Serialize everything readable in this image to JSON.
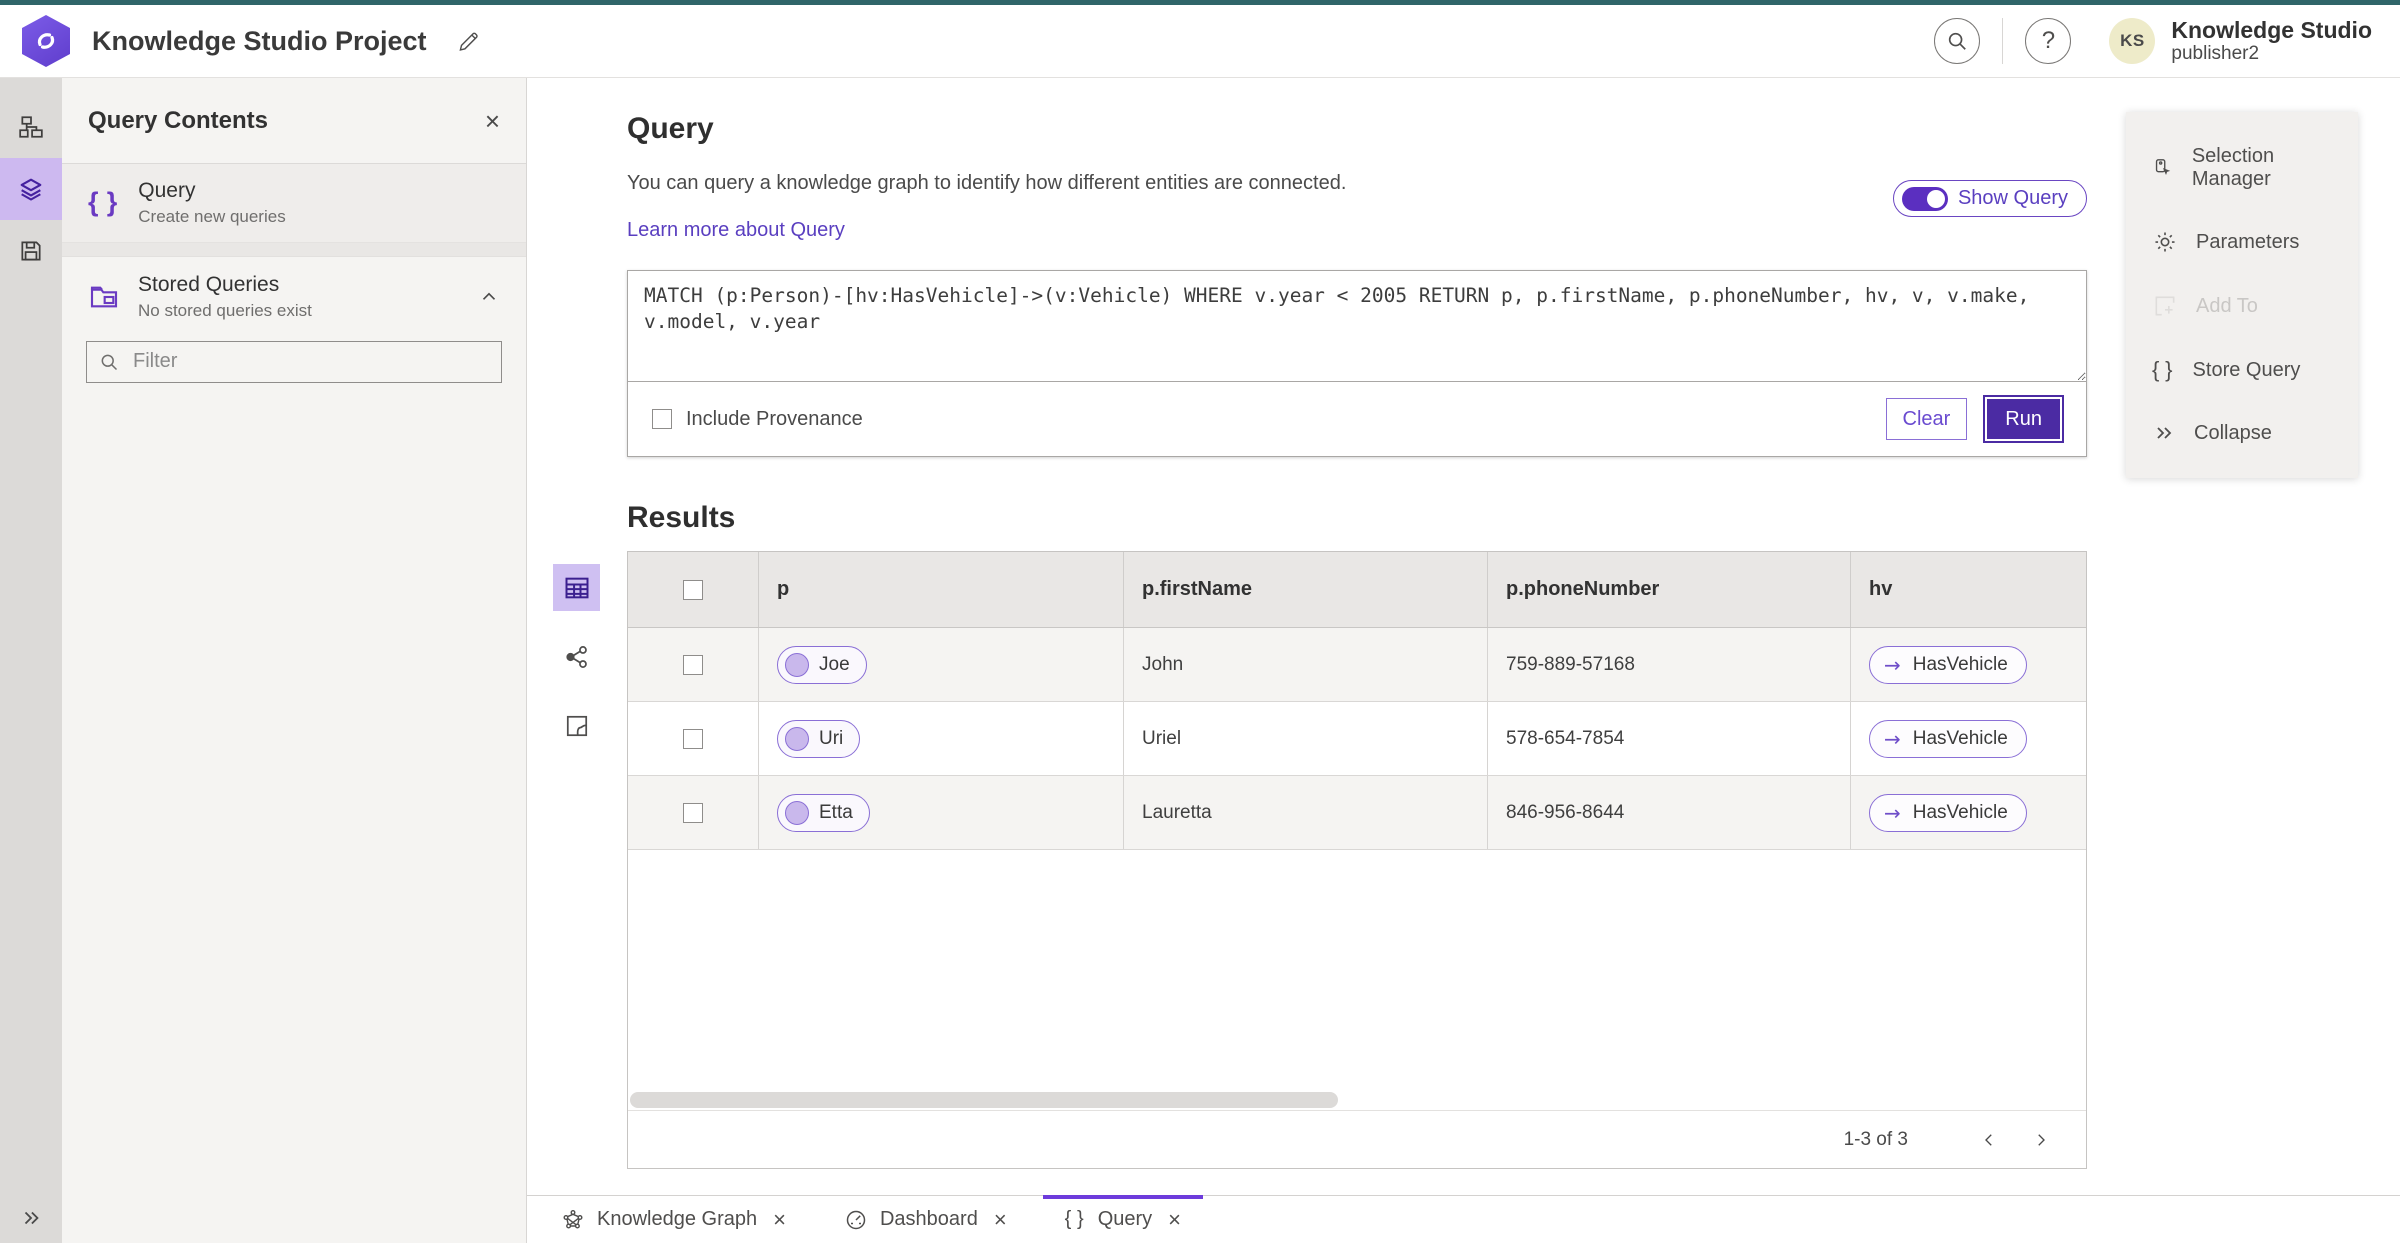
{
  "colors": {
    "top_line": "#2f6569",
    "accent_purple": "#6a3ac2",
    "run_button": "#4b2ba3",
    "selection_purple_bg": "#cdb9f0",
    "pill_border": "#8a6fd6",
    "avatar_bg": "#eeebc9",
    "active_tab_indicator": "#6d3bdb"
  },
  "topbar": {
    "project_title": "Knowledge Studio Project",
    "product_name": "Knowledge Studio",
    "user_name": "publisher2",
    "avatar_initials": "KS"
  },
  "sidebar": {
    "title": "Query Contents",
    "query_item": {
      "title": "Query",
      "subtitle": "Create new queries"
    },
    "stored_item": {
      "title": "Stored Queries",
      "subtitle": "No stored queries exist"
    },
    "filter_placeholder": "Filter"
  },
  "query_panel": {
    "heading": "Query",
    "description": "You can query a knowledge graph to identify how different entities are connected.",
    "learn_more": "Learn more about Query",
    "show_query": "Show Query",
    "query_text": "MATCH (p:Person)-[hv:HasVehicle]->(v:Vehicle) WHERE v.year < 2005 RETURN p, p.firstName, p.phoneNumber, hv, v, v.make, v.model, v.year",
    "include_provenance": "Include Provenance",
    "clear": "Clear",
    "run": "Run"
  },
  "results": {
    "heading": "Results",
    "columns": [
      "p",
      "p.firstName",
      "p.phoneNumber",
      "hv"
    ],
    "rows": [
      {
        "p": "Joe",
        "firstName": "John",
        "phone": "759-889-57168",
        "hv": "HasVehicle"
      },
      {
        "p": "Uri",
        "firstName": "Uriel",
        "phone": "578-654-7854",
        "hv": "HasVehicle"
      },
      {
        "p": "Etta",
        "firstName": "Lauretta",
        "phone": "846-956-8644",
        "hv": "HasVehicle"
      }
    ],
    "arrow": "→",
    "pagination": "1-3 of 3"
  },
  "right_panel": {
    "items": [
      {
        "label": "Selection Manager"
      },
      {
        "label": "Parameters"
      },
      {
        "label": "Add To"
      },
      {
        "label": "Store Query"
      },
      {
        "label": "Collapse"
      }
    ]
  },
  "tabs": [
    {
      "label": "Knowledge Graph"
    },
    {
      "label": "Dashboard"
    },
    {
      "label": "Query"
    }
  ]
}
